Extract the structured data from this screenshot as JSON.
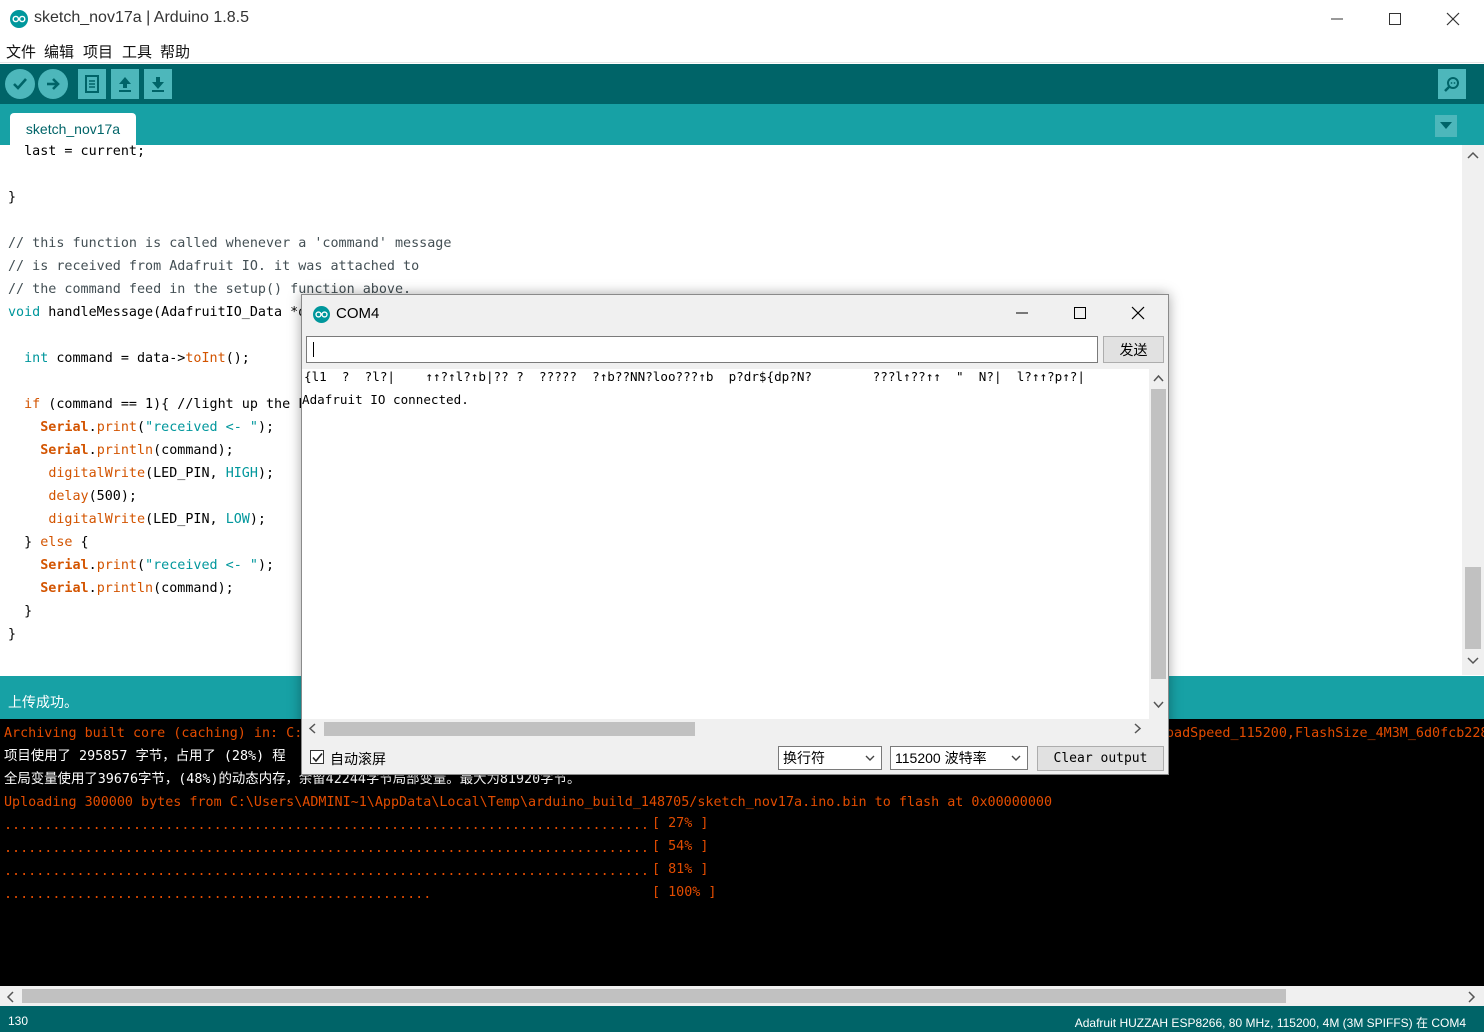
{
  "window": {
    "title": "sketch_nov17a | Arduino 1.8.5"
  },
  "menu": {
    "items": [
      "文件",
      "编辑",
      "项目",
      "工具",
      "帮助"
    ]
  },
  "tabs": [
    {
      "label": "sketch_nov17a"
    }
  ],
  "editor": {
    "lines": [
      "  last = current;",
      "",
      "}",
      "",
      "// this function is called whenever a 'command' message",
      "// is received from Adafruit IO. it was attached to",
      "// the command feed in the setup() function above.",
      "void handleMessage(AdafruitIO_Data *d",
      "",
      "  int command = data->toInt();",
      "",
      "  if (command == 1){ //light up the L",
      "    Serial.print(\"received <- \");",
      "    Serial.println(command);",
      "     digitalWrite(LED_PIN, HIGH);",
      "     delay(500);",
      "     digitalWrite(LED_PIN, LOW);",
      "  } else {",
      "    Serial.print(\"received <- \");",
      "    Serial.println(command);",
      "  }",
      "}"
    ]
  },
  "status": {
    "message": "上传成功。"
  },
  "console": {
    "archiving": "Archiving built core (caching) in: C:",
    "archiving_tail": "oadSpeed_115200,FlashSize_4M3M_6d0fcb228",
    "program_usage": "项目使用了 295857 字节，占用了 (28%) 程",
    "global_usage": "全局变量使用了39676字节，(48%)的动态内存，余留42244字节局部变量。最大为81920字节。",
    "uploading": "Uploading 300000 bytes from C:\\Users\\ADMINI~1\\AppData\\Local\\Temp\\arduino_build_148705/sketch_nov17a.ino.bin to flash at 0x00000000",
    "progress": [
      {
        "dots": "................................................................................",
        "pct": "[ 27% ]"
      },
      {
        "dots": "................................................................................",
        "pct": "[ 54% ]"
      },
      {
        "dots": "................................................................................",
        "pct": "[ 81% ]"
      },
      {
        "dots": ".....................................................",
        "pct": "[ 100% ]"
      }
    ]
  },
  "bottom": {
    "line_number": "130",
    "board": "Adafruit HUZZAH ESP8266, 80 MHz, 115200, 4M (3M SPIFFS) 在 COM4"
  },
  "serial_monitor": {
    "title": "COM4",
    "input_value": "",
    "send_label": "发送",
    "output_lines": [
      "{l1  ?  ?l?|    ↑↑?↑l?↑b|?? ?  ?????  ?↑b??NN?loo???↑b  p?dr${dp?N?        ???l↑??↑↑  \"  N?|  l?↑↑?p↑?|",
      "Adafruit IO connected."
    ],
    "autoscroll_label": "自动滚屏",
    "autoscroll_checked": true,
    "line_ending": "换行符",
    "baud_rate": "115200 波特率",
    "clear_label": "Clear output"
  },
  "colors": {
    "teal_dark": "#006468",
    "teal": "#17a1a5",
    "console_orange": "#e34c00"
  }
}
